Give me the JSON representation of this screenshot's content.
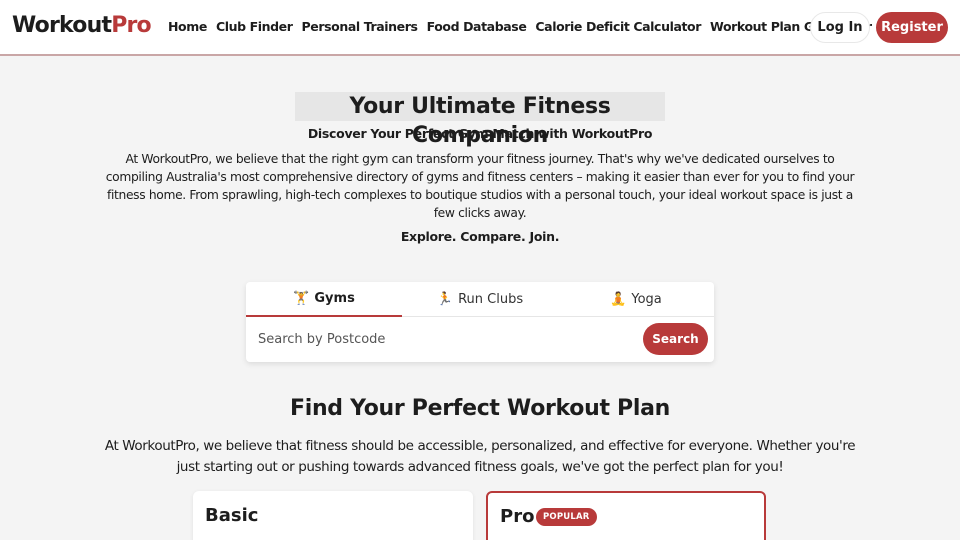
{
  "header": {
    "logo_main": "Workout",
    "logo_accent": "Pro",
    "nav": [
      "Home",
      "Club Finder",
      "Personal Trainers",
      "Food Database",
      "Calorie Deficit Calculator",
      "Workout Plan Generator"
    ],
    "login_label": "Log In",
    "register_label": "Register"
  },
  "hero": {
    "title": "Your Ultimate Fitness Companion",
    "subtitle": "Discover Your Perfect Gym Match with WorkoutPro",
    "body": "At WorkoutPro, we believe that the right gym can transform your fitness journey. That's why we've dedicated ourselves to compiling Australia's most comprehensive directory of gyms and fitness centers – making it easier than ever for you to find your fitness home. From sprawling, high-tech complexes to boutique studios with a personal touch, your ideal workout space is just a few clicks away.",
    "tagline": "Explore. Compare. Join."
  },
  "search": {
    "tabs": [
      {
        "icon": "🏋️",
        "label": "Gyms",
        "active": true
      },
      {
        "icon": "🏃",
        "label": "Run Clubs",
        "active": false
      },
      {
        "icon": "🧘",
        "label": "Yoga",
        "active": false
      }
    ],
    "placeholder": "Search by Postcode",
    "button_label": "Search"
  },
  "plans": {
    "title": "Find Your Perfect Workout Plan",
    "body": "At WorkoutPro, we believe that fitness should be accessible, personalized, and effective for everyone. Whether you're just starting out or pushing towards advanced fitness goals, we've got the perfect plan for you!",
    "cards": [
      {
        "name": "Basic"
      },
      {
        "name": "Pro",
        "badge": "POPULAR"
      }
    ]
  },
  "colors": {
    "accent": "#b83a3a",
    "background": "#f4f4f4"
  }
}
